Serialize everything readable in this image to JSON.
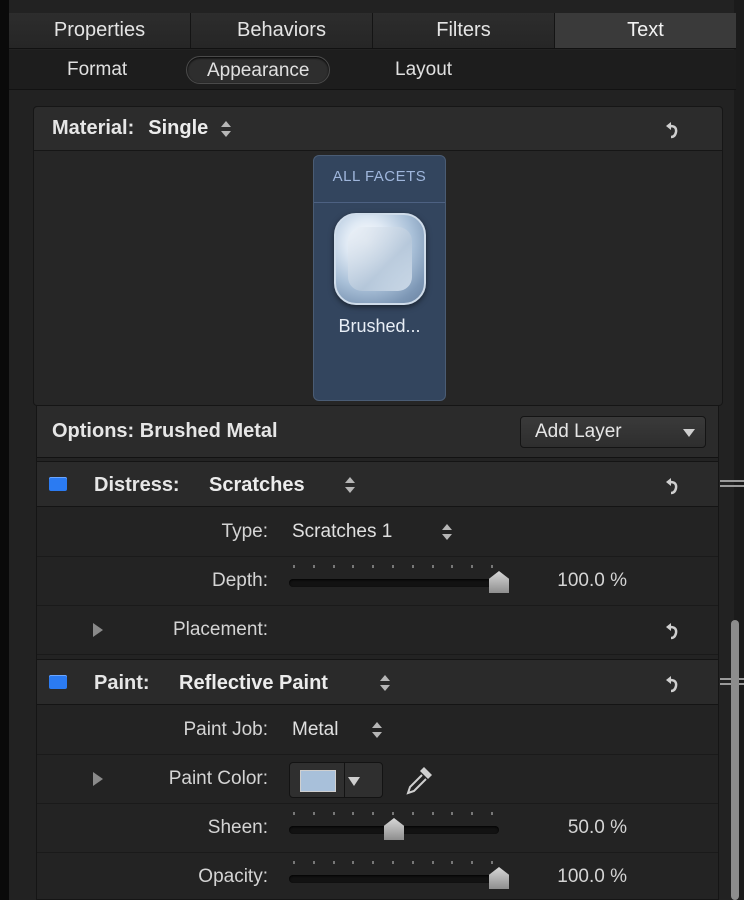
{
  "tabs": [
    {
      "label": "Properties"
    },
    {
      "label": "Behaviors"
    },
    {
      "label": "Filters"
    },
    {
      "label": "Text",
      "active": true
    }
  ],
  "subtabs": [
    {
      "label": "Format"
    },
    {
      "label": "Appearance",
      "active": true
    },
    {
      "label": "Layout"
    }
  ],
  "material": {
    "label": "Material:",
    "value": "Single",
    "facet_label": "ALL FACETS",
    "facet_name": "Brushed..."
  },
  "options": {
    "title": "Options: Brushed Metal",
    "add_layer_label": "Add Layer"
  },
  "distress": {
    "label": "Distress:",
    "value": "Scratches",
    "type_label": "Type:",
    "type_value": "Scratches 1",
    "depth_label": "Depth:",
    "depth_value": "100.0",
    "depth_unit": "%",
    "depth_fraction": 1.0,
    "placement_label": "Placement:"
  },
  "paint": {
    "label": "Paint:",
    "value": "Reflective Paint",
    "job_label": "Paint Job:",
    "job_value": "Metal",
    "color_label": "Paint Color:",
    "color_value": "#a8c0da",
    "sheen_label": "Sheen:",
    "sheen_value": "50.0",
    "sheen_unit": "%",
    "sheen_fraction": 0.5,
    "opacity_label": "Opacity:",
    "opacity_value": "100.0",
    "opacity_unit": "%",
    "opacity_fraction": 1.0
  },
  "colors": {
    "accent_blue": "#2b7bf2",
    "facet_bg": "#33455e"
  }
}
